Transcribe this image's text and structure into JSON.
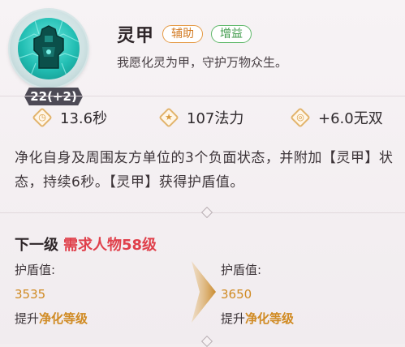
{
  "skill": {
    "name": "灵甲",
    "tags": [
      "辅助",
      "增益"
    ],
    "flavor": "我愿化灵为甲，守护万物众生。",
    "level_badge": "22(+2)",
    "icon": "spirit-armor-icon"
  },
  "stats": {
    "cooldown": "13.6秒",
    "mana": "107法力",
    "musou": "+6.0无双"
  },
  "description": "净化自身及周围友方单位的3个负面状态，并附加【灵甲】状态，持续6秒。【灵甲】获得护盾值。",
  "next_level": {
    "label": "下一级",
    "requirement": "需求人物58级",
    "current": {
      "key": "护盾值:",
      "value": "3535",
      "upgrade_prefix": "提升",
      "upgrade_item": "净化等级"
    },
    "next": {
      "key": "护盾值:",
      "value": "3650",
      "upgrade_prefix": "提升",
      "upgrade_item": "净化等级"
    }
  },
  "colors": {
    "accent_gold": "#d08a22",
    "requirement_red": "#e0404b",
    "tag_orange": "#d27a22",
    "tag_green": "#3f9a4a"
  }
}
